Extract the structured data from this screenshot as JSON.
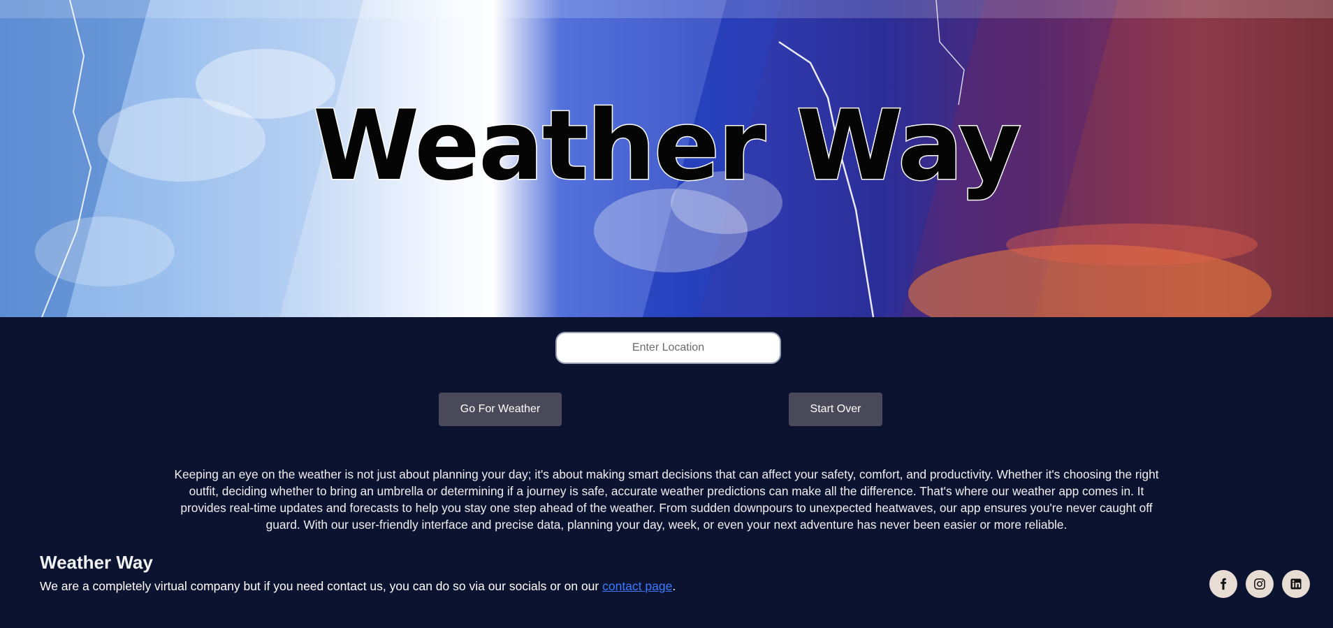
{
  "hero": {
    "title": "Weather Way"
  },
  "search": {
    "placeholder": "Enter Location",
    "value": ""
  },
  "actions": {
    "go_label": "Go For Weather",
    "reset_label": "Start Over"
  },
  "intro": {
    "text": "Keeping an eye on the weather is not just about planning your day; it's about making smart decisions that can affect your safety, comfort, and productivity. Whether it's choosing the right outfit, deciding whether to bring an umbrella or determining if a journey is safe, accurate weather predictions can make all the difference. That's where our weather app comes in. It provides real-time updates and forecasts to help you stay one step ahead of the weather. From sudden downpours to unexpected heatwaves, our app ensures you're never caught off guard. With our user-friendly interface and precise data, planning your day, week, or even your next adventure has never been easier or more reliable."
  },
  "footer": {
    "title": "Weather Way",
    "text_before": "We are a completely virtual company but if you need contact us, you can do so via our socials or on our ",
    "link_label": "contact page",
    "text_after": "."
  },
  "socials": [
    {
      "icon": "facebook-icon"
    },
    {
      "icon": "instagram-icon"
    },
    {
      "icon": "linkedin-icon"
    }
  ],
  "colors": {
    "page_background": "#0c1330",
    "button_background": "#4a4959",
    "link": "#3a7bff",
    "social_circle": "#e8ddd4"
  }
}
